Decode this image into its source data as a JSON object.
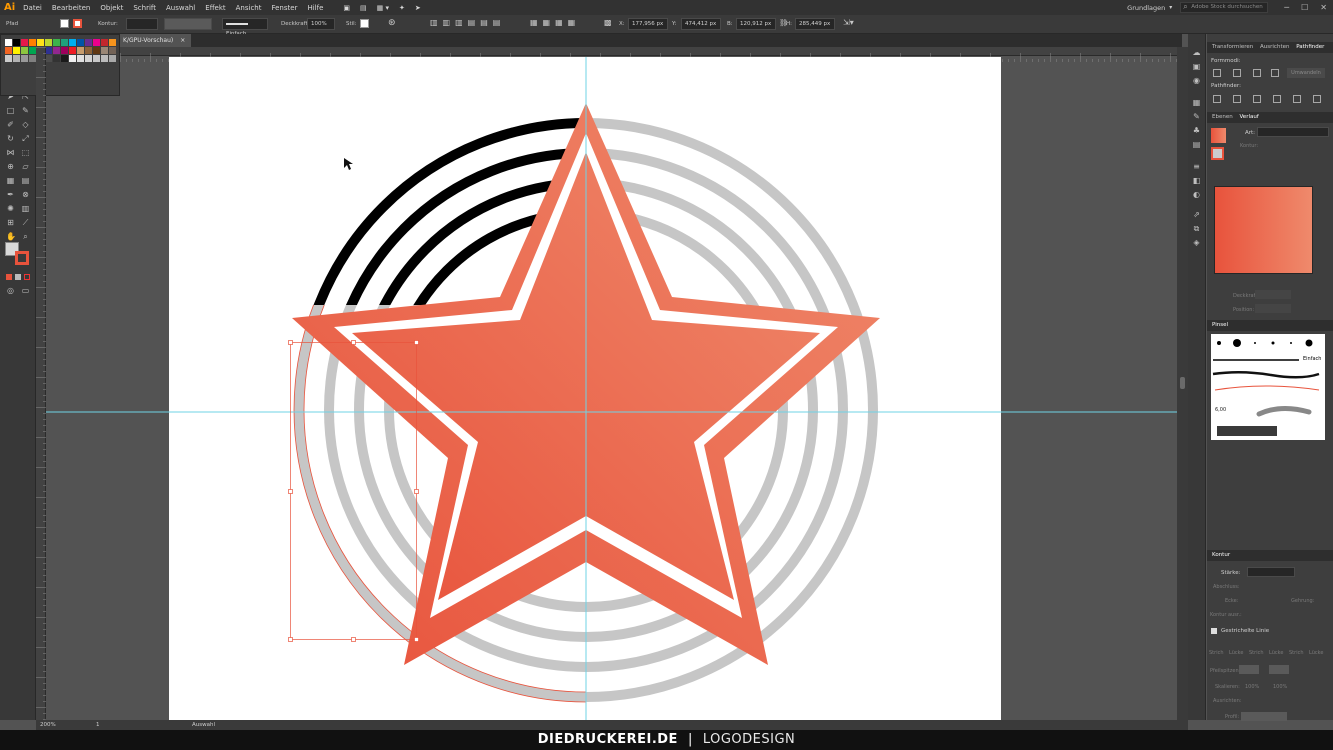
{
  "app": {
    "logo": "Ai",
    "menu": [
      "Datei",
      "Bearbeiten",
      "Objekt",
      "Schrift",
      "Auswahl",
      "Effekt",
      "Ansicht",
      "Fenster",
      "Hilfe"
    ],
    "workspace": "Grundlagen",
    "search_placeholder": "Adobe Stock durchsuchen"
  },
  "control_bar": {
    "object_type": "Pfad",
    "stroke_label": "Kontur:",
    "stroke_style": "Einfach",
    "opacity_label": "Deckkraft:",
    "opacity_value": "100%",
    "style_label": "Stil:",
    "x_label": "X:",
    "x_value": "177,956 px",
    "y_label": "Y:",
    "y_value": "474,412 px",
    "w_label": "B:",
    "w_value": "120,912 px",
    "h_label": "H:",
    "h_value": "285,449 px"
  },
  "document": {
    "tab_title": "K/GPU-Vorschau)",
    "zoom": "200%",
    "artboard_number": "1",
    "status_tool": "Auswahl"
  },
  "right_panel": {
    "tabs_top": [
      "Transformieren",
      "Ausrichten",
      "Pathfinder"
    ],
    "formmodi_label": "Formmodi:",
    "umwandeln_label": "Umwandeln",
    "pathfinder_label": "Pathfinder:",
    "tabs_gradient": [
      "Ebenen",
      "Verlauf"
    ],
    "art_label": "Art:",
    "kontur_label": "Kontur:",
    "deckkraft_label": "Deckkraft:",
    "position_label": "Position:",
    "gradient_colors": [
      "#e8533c",
      "#ef8a6c"
    ],
    "brush_tab": "Pinsel",
    "brush_einfach": "Einfach",
    "brush_size": "6,00",
    "kontur_tab": "Kontur",
    "staerke_label": "Stärke:",
    "abschluss_label": "Abschluss:",
    "ecke_label": "Ecke:",
    "gehrung_label": "Gehrung:",
    "kontur_ausr_label": "Kontur ausr.:",
    "gestrichelte_label": "Gestrichelte Linie",
    "strich_label": "Strich",
    "luecke_label": "Lücke",
    "pfeilspitzen_label": "Pfeilspitzen:",
    "skalieren_label": "Skalieren:",
    "skalieren_a": "100%",
    "skalieren_b": "100%",
    "ausrichten_label": "Ausrichten:",
    "profil_label": "Profil:"
  },
  "footer": {
    "brand": "DIEDRUCKEREI.DE",
    "separator": "|",
    "tag": "LOGODESIGN"
  },
  "colors": {
    "star_fill_start": "#e8533c",
    "star_fill_end": "#ef8a6c",
    "black_arcs": "#000000",
    "grey_arcs": "#c6c6c6",
    "guide": "#6fd3e6",
    "selection": "#e8533c"
  }
}
